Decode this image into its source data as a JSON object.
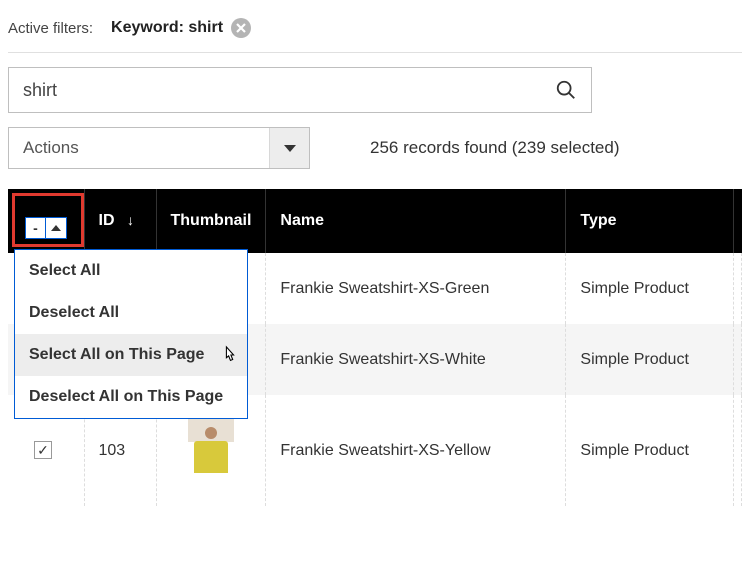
{
  "filters": {
    "label": "Active filters:",
    "chip_label": "Keyword: shirt"
  },
  "search": {
    "value": "shirt"
  },
  "actions": {
    "label": "Actions"
  },
  "records_found": "256 records found (239 selected)",
  "columns": {
    "id": "ID",
    "thumbnail": "Thumbnail",
    "name": "Name",
    "type": "Type"
  },
  "select_menu": {
    "items": [
      "Select All",
      "Deselect All",
      "Select All on This Page",
      "Deselect All on This Page"
    ]
  },
  "rows": [
    {
      "checked": false,
      "id": "",
      "thumb": null,
      "name": "Frankie  Sweatshirt-XS-Green",
      "type": "Simple Product"
    },
    {
      "checked": false,
      "id": "",
      "thumb": null,
      "name": "Frankie  Sweatshirt-XS-White",
      "type": "Simple Product"
    },
    {
      "checked": true,
      "id": "103",
      "thumb": "yellow",
      "name": "Frankie  Sweatshirt-XS-Yellow",
      "type": "Simple Product"
    }
  ],
  "hdr_select_indicator": "-"
}
